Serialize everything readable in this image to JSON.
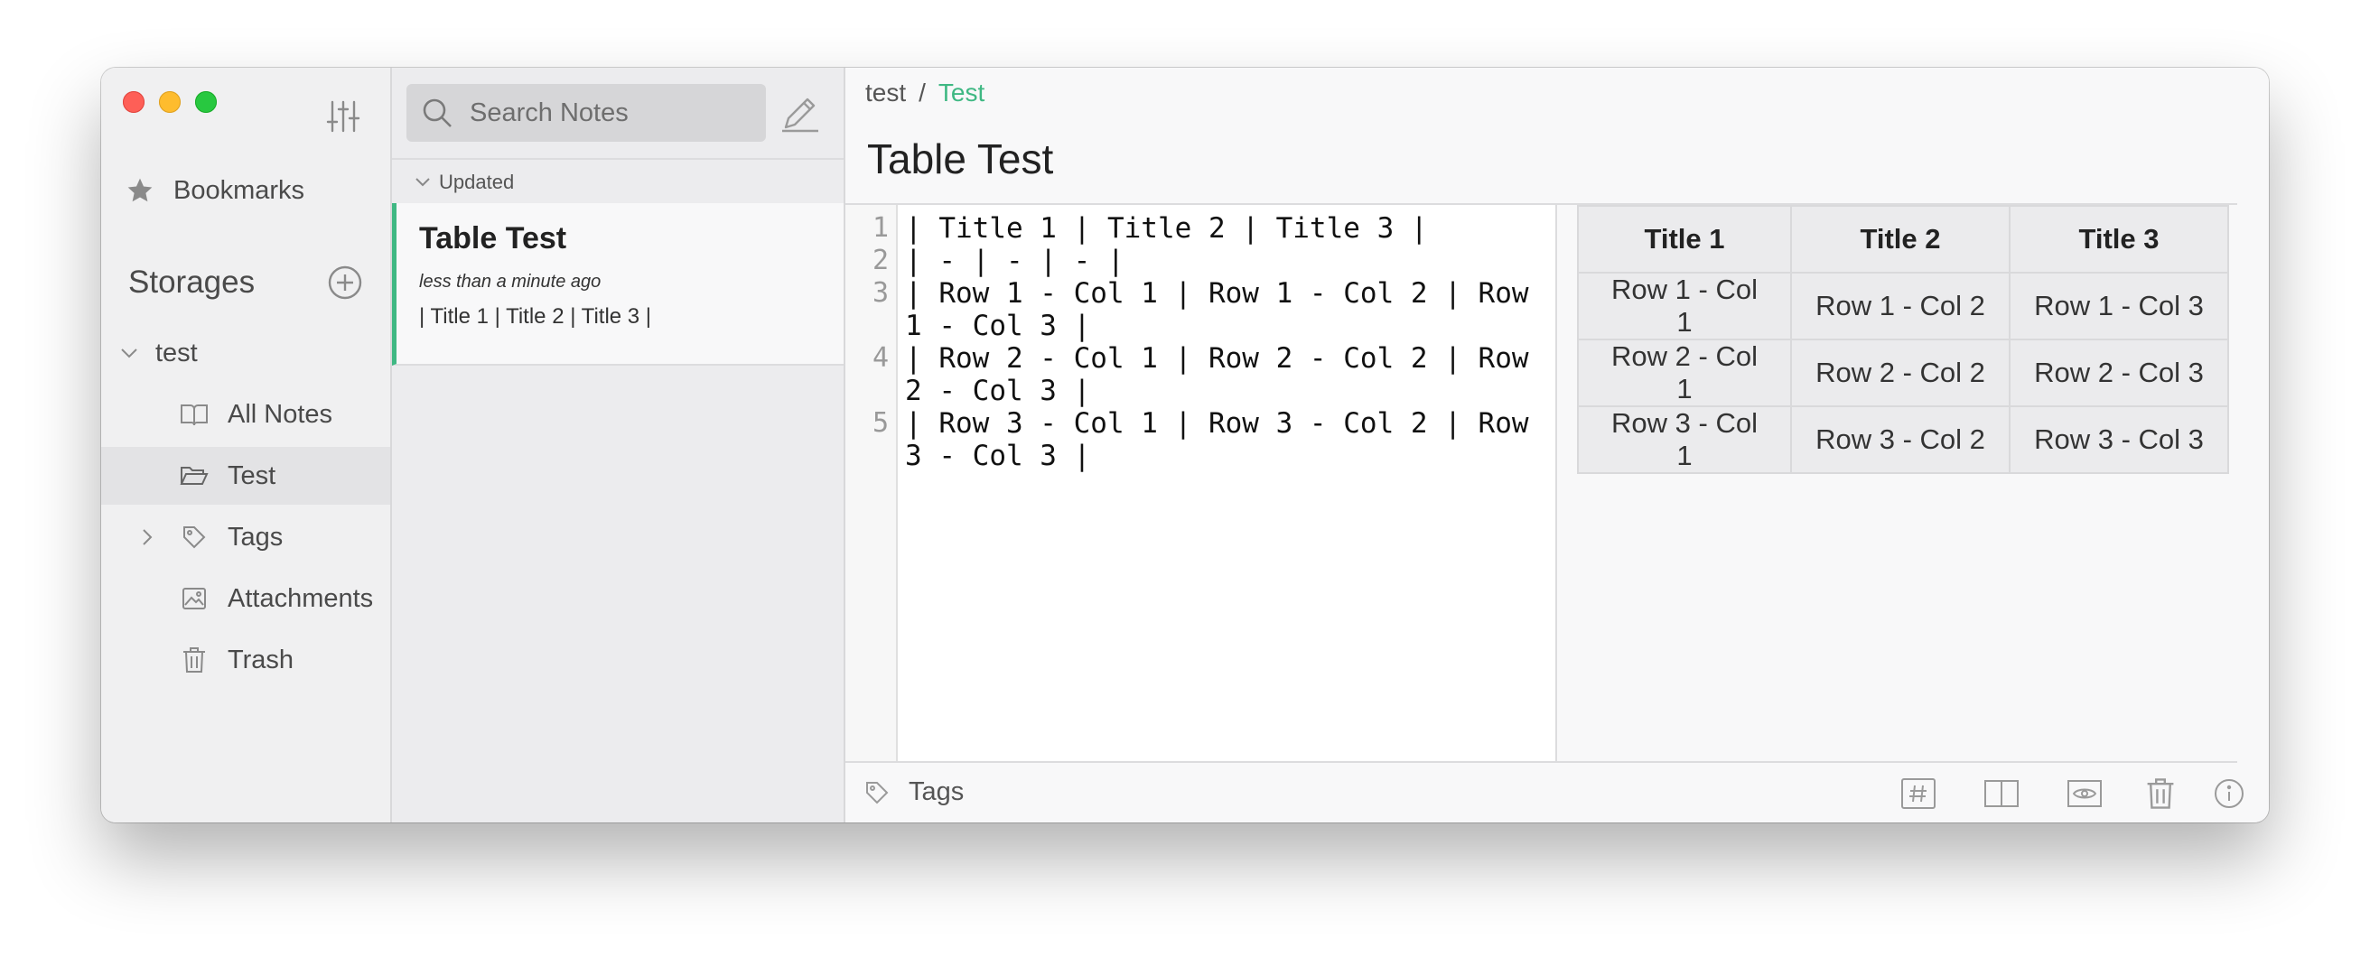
{
  "sidebar": {
    "bookmarks_label": "Bookmarks",
    "storages_title": "Storages",
    "storage_name": "test",
    "items": [
      {
        "label": "All Notes",
        "icon": "book-icon"
      },
      {
        "label": "Test",
        "icon": "folder-open-icon",
        "active": true
      },
      {
        "label": "Tags",
        "icon": "tag-icon"
      },
      {
        "label": "Attachments",
        "icon": "image-icon"
      },
      {
        "label": "Trash",
        "icon": "trash-icon"
      }
    ]
  },
  "notelist": {
    "search_placeholder": "Search Notes",
    "sort_label": "Updated",
    "notes": [
      {
        "title": "Table Test",
        "time": "less than a minute ago",
        "preview": "| Title 1 | Title 2 | Title 3 |"
      }
    ]
  },
  "editor": {
    "breadcrumb": {
      "storage": "test",
      "separator": "/",
      "folder": "Test"
    },
    "title": "Table Test",
    "line_numbers": [
      "1",
      "2",
      "3",
      "4",
      "5"
    ],
    "lines": [
      "| Title 1 | Title 2 | Title 3 |",
      "| - | - | - |",
      "| Row 1 - Col 1 | Row 1 - Col 2 | Row 1 - Col 3 |",
      "| Row 2 - Col 1 | Row 2 - Col 2 | Row 2 - Col 3 |",
      "| Row 3 - Col 1 | Row 3 - Col 2 | Row 3 - Col 3 |"
    ]
  },
  "preview": {
    "headers": [
      "Title 1",
      "Title 2",
      "Title 3"
    ],
    "rows": [
      [
        "Row 1 - Col 1",
        "Row 1 - Col 2",
        "Row 1 - Col 3"
      ],
      [
        "Row 2 - Col 1",
        "Row 2 - Col 2",
        "Row 2 - Col 3"
      ],
      [
        "Row 3 - Col 1",
        "Row 3 - Col 2",
        "Row 3 - Col 3"
      ]
    ]
  },
  "statusbar": {
    "tags_label": "Tags"
  },
  "colors": {
    "accent": "#3fb883",
    "close": "#fe5f57",
    "minimize": "#febc2e",
    "maximize": "#28c840"
  }
}
